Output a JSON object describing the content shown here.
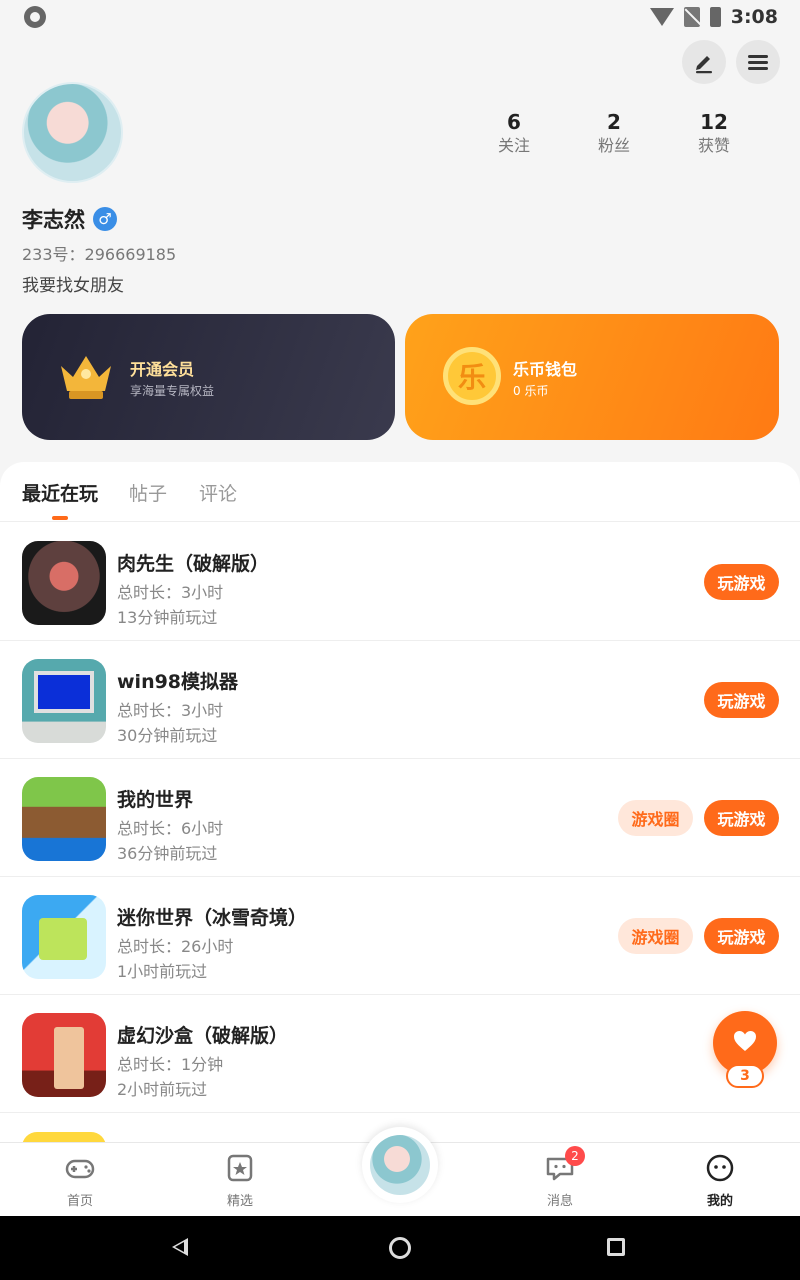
{
  "status_bar": {
    "time": "3:08",
    "icons": [
      "app-notification-icon",
      "wifi-icon",
      "no-sim-icon",
      "battery-icon"
    ]
  },
  "header_actions": {
    "edit_icon": "edit-icon",
    "menu_icon": "menu-icon"
  },
  "profile": {
    "name": "李志然",
    "gender_symbol": "♂",
    "uid": "233号：296669185",
    "bio": "我要找女朋友",
    "stats": [
      {
        "value": "6",
        "label": "关注"
      },
      {
        "value": "2",
        "label": "粉丝"
      },
      {
        "value": "12",
        "label": "获赞"
      }
    ]
  },
  "cards": {
    "vip": {
      "title": "开通会员",
      "subtitle": "享海量专属权益"
    },
    "wallet": {
      "title": "乐币钱包",
      "subtitle": "0 乐币",
      "coin_symbol": "乐"
    }
  },
  "tabs": [
    {
      "label": "最近在玩",
      "active": true
    },
    {
      "label": "帖子",
      "active": false
    },
    {
      "label": "评论",
      "active": false
    }
  ],
  "games": [
    {
      "title": "肉先生（破解版）",
      "duration": "总时长：3小时",
      "last_played": "13分钟前玩过",
      "play_label": "玩游戏",
      "circle_label": ""
    },
    {
      "title": "win98模拟器",
      "duration": "总时长：3小时",
      "last_played": "30分钟前玩过",
      "play_label": "玩游戏",
      "circle_label": ""
    },
    {
      "title": "我的世界",
      "duration": "总时长：6小时",
      "last_played": "36分钟前玩过",
      "play_label": "玩游戏",
      "circle_label": "游戏圈"
    },
    {
      "title": "迷你世界（冰雪奇境）",
      "duration": "总时长：26小时",
      "last_played": "1小时前玩过",
      "play_label": "玩游戏",
      "circle_label": "游戏圈"
    },
    {
      "title": "虚幻沙盒（破解版）",
      "duration": "总时长：1分钟",
      "last_played": "2小时前玩过",
      "play_label": "",
      "circle_label": ""
    }
  ],
  "floating_like": {
    "count": "3",
    "icon": "heart-icon"
  },
  "bottom_nav": [
    {
      "label": "首页",
      "icon": "gamepad-icon",
      "active": false
    },
    {
      "label": "精选",
      "icon": "star-card-icon",
      "active": false
    },
    {
      "label": "消息",
      "icon": "message-icon",
      "active": false,
      "badge": "2"
    },
    {
      "label": "我的",
      "icon": "face-icon",
      "active": true
    }
  ],
  "colors": {
    "accent": "#FF6A1A",
    "vip_card": "#2B2B3C",
    "wallet_card": "#FF8A16",
    "badge": "#FF4B4B"
  }
}
